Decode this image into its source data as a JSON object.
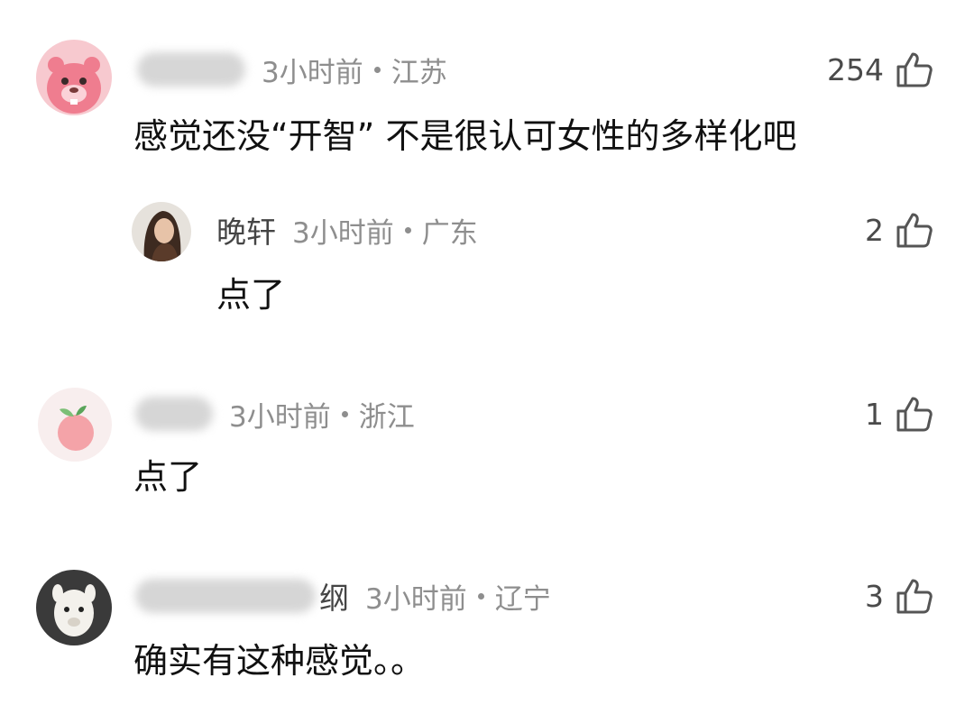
{
  "comments": [
    {
      "username": "",
      "time": "3小时前",
      "region": "江苏",
      "likes": "254",
      "text": "感觉还没“开智” 不是很认可女性的多样化吧",
      "avatar_icon": "pink-beaver-avatar-icon"
    },
    {
      "username": "晚轩",
      "time": "3小时前",
      "region": "广东",
      "likes": "2",
      "text": "点了",
      "avatar_icon": "woman-portrait-avatar-icon"
    },
    {
      "username": "",
      "time": "3小时前",
      "region": "浙江",
      "likes": "1",
      "text": "点了",
      "avatar_icon": "peach-avatar-icon"
    },
    {
      "username": "纲",
      "time": "3小时前",
      "region": "辽宁",
      "likes": "3",
      "text": "确实有这种感觉。。",
      "avatar_icon": "alpaca-avatar-icon"
    }
  ]
}
